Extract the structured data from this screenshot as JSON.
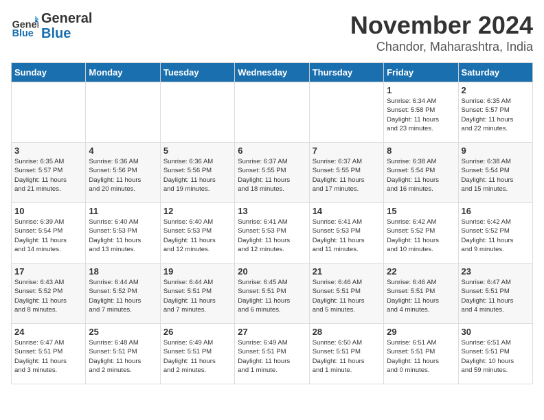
{
  "header": {
    "logo_general": "General",
    "logo_blue": "Blue",
    "month_title": "November 2024",
    "location": "Chandor, Maharashtra, India"
  },
  "days_of_week": [
    "Sunday",
    "Monday",
    "Tuesday",
    "Wednesday",
    "Thursday",
    "Friday",
    "Saturday"
  ],
  "weeks": [
    [
      {
        "day": "",
        "info": ""
      },
      {
        "day": "",
        "info": ""
      },
      {
        "day": "",
        "info": ""
      },
      {
        "day": "",
        "info": ""
      },
      {
        "day": "",
        "info": ""
      },
      {
        "day": "1",
        "info": "Sunrise: 6:34 AM\nSunset: 5:58 PM\nDaylight: 11 hours\nand 23 minutes."
      },
      {
        "day": "2",
        "info": "Sunrise: 6:35 AM\nSunset: 5:57 PM\nDaylight: 11 hours\nand 22 minutes."
      }
    ],
    [
      {
        "day": "3",
        "info": "Sunrise: 6:35 AM\nSunset: 5:57 PM\nDaylight: 11 hours\nand 21 minutes."
      },
      {
        "day": "4",
        "info": "Sunrise: 6:36 AM\nSunset: 5:56 PM\nDaylight: 11 hours\nand 20 minutes."
      },
      {
        "day": "5",
        "info": "Sunrise: 6:36 AM\nSunset: 5:56 PM\nDaylight: 11 hours\nand 19 minutes."
      },
      {
        "day": "6",
        "info": "Sunrise: 6:37 AM\nSunset: 5:55 PM\nDaylight: 11 hours\nand 18 minutes."
      },
      {
        "day": "7",
        "info": "Sunrise: 6:37 AM\nSunset: 5:55 PM\nDaylight: 11 hours\nand 17 minutes."
      },
      {
        "day": "8",
        "info": "Sunrise: 6:38 AM\nSunset: 5:54 PM\nDaylight: 11 hours\nand 16 minutes."
      },
      {
        "day": "9",
        "info": "Sunrise: 6:38 AM\nSunset: 5:54 PM\nDaylight: 11 hours\nand 15 minutes."
      }
    ],
    [
      {
        "day": "10",
        "info": "Sunrise: 6:39 AM\nSunset: 5:54 PM\nDaylight: 11 hours\nand 14 minutes."
      },
      {
        "day": "11",
        "info": "Sunrise: 6:40 AM\nSunset: 5:53 PM\nDaylight: 11 hours\nand 13 minutes."
      },
      {
        "day": "12",
        "info": "Sunrise: 6:40 AM\nSunset: 5:53 PM\nDaylight: 11 hours\nand 12 minutes."
      },
      {
        "day": "13",
        "info": "Sunrise: 6:41 AM\nSunset: 5:53 PM\nDaylight: 11 hours\nand 12 minutes."
      },
      {
        "day": "14",
        "info": "Sunrise: 6:41 AM\nSunset: 5:53 PM\nDaylight: 11 hours\nand 11 minutes."
      },
      {
        "day": "15",
        "info": "Sunrise: 6:42 AM\nSunset: 5:52 PM\nDaylight: 11 hours\nand 10 minutes."
      },
      {
        "day": "16",
        "info": "Sunrise: 6:42 AM\nSunset: 5:52 PM\nDaylight: 11 hours\nand 9 minutes."
      }
    ],
    [
      {
        "day": "17",
        "info": "Sunrise: 6:43 AM\nSunset: 5:52 PM\nDaylight: 11 hours\nand 8 minutes."
      },
      {
        "day": "18",
        "info": "Sunrise: 6:44 AM\nSunset: 5:52 PM\nDaylight: 11 hours\nand 7 minutes."
      },
      {
        "day": "19",
        "info": "Sunrise: 6:44 AM\nSunset: 5:51 PM\nDaylight: 11 hours\nand 7 minutes."
      },
      {
        "day": "20",
        "info": "Sunrise: 6:45 AM\nSunset: 5:51 PM\nDaylight: 11 hours\nand 6 minutes."
      },
      {
        "day": "21",
        "info": "Sunrise: 6:46 AM\nSunset: 5:51 PM\nDaylight: 11 hours\nand 5 minutes."
      },
      {
        "day": "22",
        "info": "Sunrise: 6:46 AM\nSunset: 5:51 PM\nDaylight: 11 hours\nand 4 minutes."
      },
      {
        "day": "23",
        "info": "Sunrise: 6:47 AM\nSunset: 5:51 PM\nDaylight: 11 hours\nand 4 minutes."
      }
    ],
    [
      {
        "day": "24",
        "info": "Sunrise: 6:47 AM\nSunset: 5:51 PM\nDaylight: 11 hours\nand 3 minutes."
      },
      {
        "day": "25",
        "info": "Sunrise: 6:48 AM\nSunset: 5:51 PM\nDaylight: 11 hours\nand 2 minutes."
      },
      {
        "day": "26",
        "info": "Sunrise: 6:49 AM\nSunset: 5:51 PM\nDaylight: 11 hours\nand 2 minutes."
      },
      {
        "day": "27",
        "info": "Sunrise: 6:49 AM\nSunset: 5:51 PM\nDaylight: 11 hours\nand 1 minute."
      },
      {
        "day": "28",
        "info": "Sunrise: 6:50 AM\nSunset: 5:51 PM\nDaylight: 11 hours\nand 1 minute."
      },
      {
        "day": "29",
        "info": "Sunrise: 6:51 AM\nSunset: 5:51 PM\nDaylight: 11 hours\nand 0 minutes."
      },
      {
        "day": "30",
        "info": "Sunrise: 6:51 AM\nSunset: 5:51 PM\nDaylight: 10 hours\nand 59 minutes."
      }
    ]
  ]
}
